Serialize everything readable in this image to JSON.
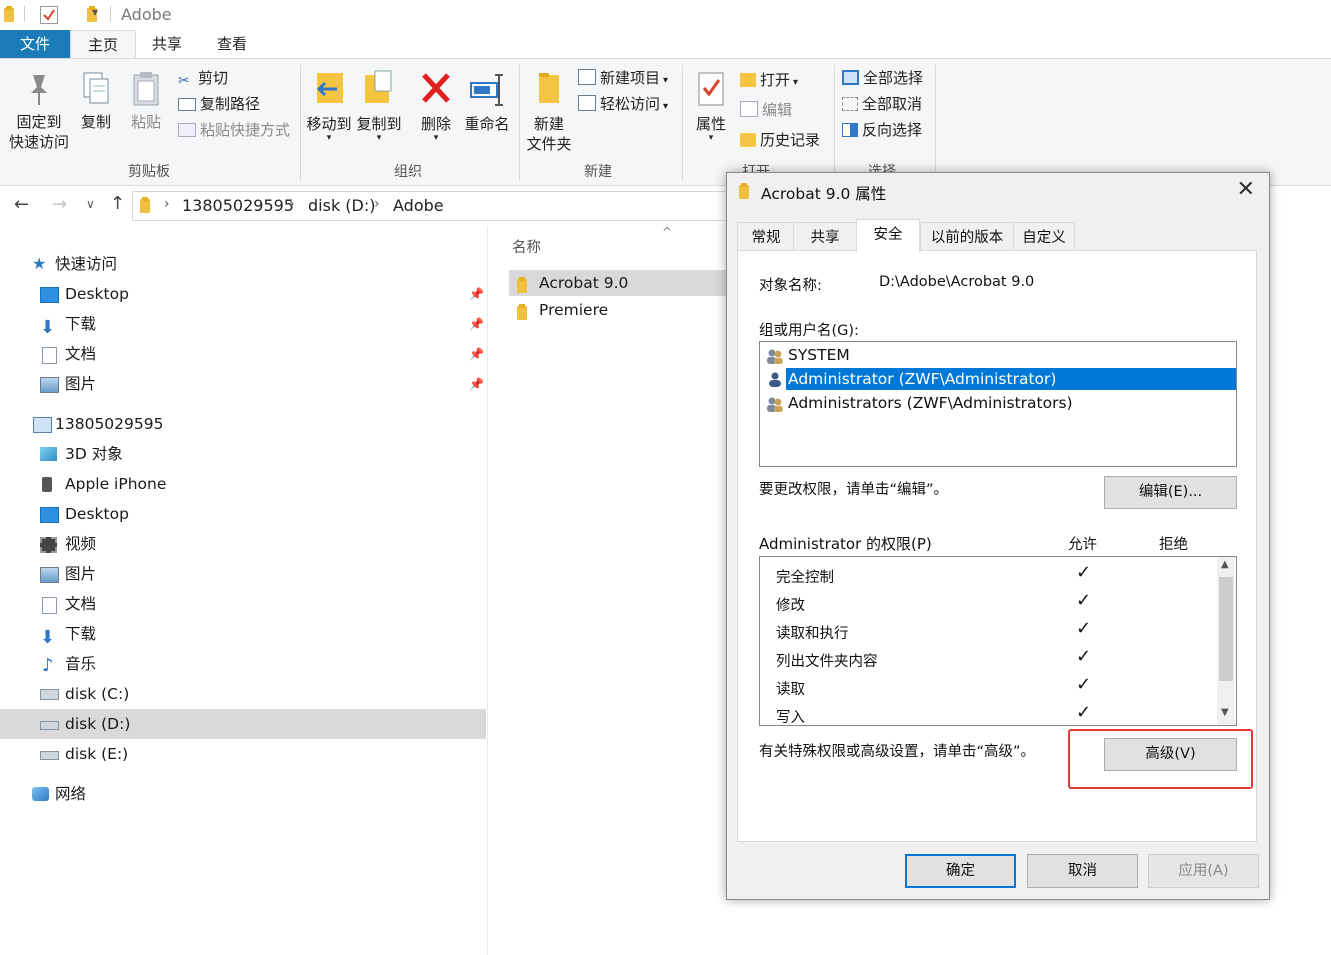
{
  "window": {
    "title": "Adobe"
  },
  "ribbon_tabs": {
    "file": "文件",
    "home": "主页",
    "share": "共享",
    "view": "查看"
  },
  "ribbon": {
    "pin_line1": "固定到",
    "pin_line2": "快速访问",
    "copy": "复制",
    "paste": "粘贴",
    "cut": "剪切",
    "copy_path": "复制路径",
    "paste_shortcut": "粘贴快捷方式",
    "group_clipboard": "剪贴板",
    "move_to": "移动到",
    "copy_to": "复制到",
    "delete": "删除",
    "rename": "重命名",
    "group_organize": "组织",
    "new_folder_line1": "新建",
    "new_folder_line2": "文件夹",
    "new_item": "新建项目",
    "easy_access": "轻松访问",
    "group_new": "新建",
    "properties": "属性",
    "open": "打开",
    "edit": "编辑",
    "history": "历史记录",
    "group_open": "打开",
    "select_all": "全部选择",
    "select_none": "全部取消",
    "invert_selection": "反向选择",
    "group_select": "选择"
  },
  "address": {
    "segments": [
      "13805029595",
      "disk (D:)",
      "Adobe"
    ]
  },
  "nav": {
    "quick_access": "快速访问",
    "qa_items": [
      "Desktop",
      "下载",
      "文档",
      "图片"
    ],
    "this_pc": "13805029595",
    "pc_items": [
      "3D 对象",
      "Apple iPhone",
      "Desktop",
      "视频",
      "图片",
      "文档",
      "下载",
      "音乐",
      "disk (C:)",
      "disk (D:)",
      "disk (E:)"
    ],
    "network": "网络"
  },
  "files": {
    "column_name": "名称",
    "items": [
      "Acrobat 9.0",
      "Premiere"
    ]
  },
  "dialog": {
    "title": "Acrobat 9.0 属性",
    "tabs": [
      "常规",
      "共享",
      "安全",
      "以前的版本",
      "自定义"
    ],
    "object_label": "对象名称:",
    "object_value": "D:\\Adobe\\Acrobat 9.0",
    "groups_label": "组或用户名(G):",
    "users": [
      "SYSTEM",
      "Administrator (ZWF\\Administrator)",
      "Administrators (ZWF\\Administrators)"
    ],
    "change_hint": "要更改权限，请单击“编辑”。",
    "edit_button": "编辑(E)...",
    "perm_label": "Administrator 的权限(P)",
    "allow": "允许",
    "deny": "拒绝",
    "permissions": [
      "完全控制",
      "修改",
      "读取和执行",
      "列出文件夹内容",
      "读取",
      "写入"
    ],
    "advanced_hint": "有关特殊权限或高级设置，请单击“高级”。",
    "advanced_button": "高级(V)",
    "ok": "确定",
    "cancel": "取消",
    "apply": "应用(A)"
  }
}
